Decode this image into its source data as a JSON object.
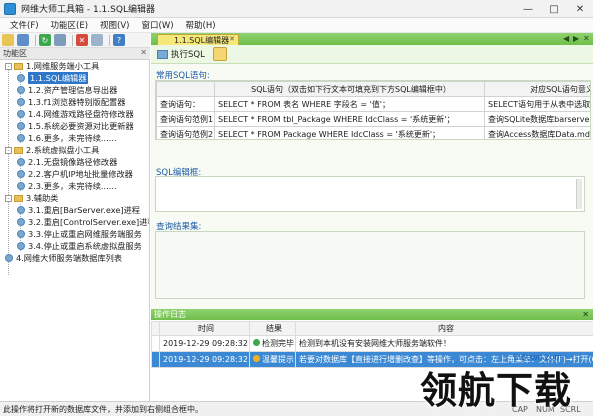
{
  "window": {
    "title": "网维大师工具箱 - 1.1.SQL编辑器"
  },
  "menu": [
    "文件(F)",
    "功能区(E)",
    "视图(V)",
    "窗口(W)",
    "帮助(H)"
  ],
  "left_panel": {
    "title": "功能区"
  },
  "tree": [
    {
      "label": "1.网维服务端小工具",
      "level": 0,
      "kind": "folder",
      "expanded": true
    },
    {
      "label": "1.1.SQL编辑器",
      "level": 1,
      "kind": "leaf",
      "selected": true
    },
    {
      "label": "1.2.资产管理信息导出器",
      "level": 1,
      "kind": "leaf"
    },
    {
      "label": "1.3.f1浏览器特别版配置器",
      "level": 1,
      "kind": "leaf"
    },
    {
      "label": "1.4.网维游戏路径盘符修改器",
      "level": 1,
      "kind": "leaf"
    },
    {
      "label": "1.5.系统必要资源对比更新器",
      "level": 1,
      "kind": "leaf"
    },
    {
      "label": "1.6.更多，未完待续......",
      "level": 1,
      "kind": "leaf"
    },
    {
      "label": "2.系统虚拟盘小工具",
      "level": 0,
      "kind": "folder",
      "expanded": true
    },
    {
      "label": "2.1.无盘镜像路径修改器",
      "level": 1,
      "kind": "leaf"
    },
    {
      "label": "2.2.客户机IP地址批量修改器",
      "level": 1,
      "kind": "leaf"
    },
    {
      "label": "2.3.更多，未完待续......",
      "level": 1,
      "kind": "leaf"
    },
    {
      "label": "3.辅助类",
      "level": 0,
      "kind": "folder",
      "expanded": true
    },
    {
      "label": "3.1.重启[BarServer.exe]进程",
      "level": 1,
      "kind": "leaf"
    },
    {
      "label": "3.2.重启[ControlServer.exe]进程",
      "level": 1,
      "kind": "leaf"
    },
    {
      "label": "3.3.停止或重启网维服务端服务",
      "level": 1,
      "kind": "leaf"
    },
    {
      "label": "3.4.停止或重启系统虚拟盘服务",
      "level": 1,
      "kind": "leaf"
    },
    {
      "label": "4.网维大师服务端数据库列表",
      "level": 0,
      "kind": "leaf"
    }
  ],
  "tab": {
    "label": "1.1.SQL编辑器"
  },
  "toolbar": {
    "execute_label": "执行SQL"
  },
  "common_sql": {
    "title": "常用SQL语句:",
    "columns": [
      "",
      "SQL语句（双击如下行文本可填充到下方SQL编辑框中）",
      "对应SQL语句意义"
    ],
    "rows": [
      [
        "查询语句：",
        "SELECT * FROM 表名 WHERE 字段名 = '值'；",
        "SELECT语句用于从表中选取"
      ],
      [
        "查询语句范例1：",
        "SELECT * FROM tbl_Package WHERE IdcClass = '系统更新'；",
        "查询SQLite数据库barserve"
      ],
      [
        "查询语句范例2：",
        "SELECT * FROM Package WHERE IdcClass = '系统更新'；",
        "查询Access数据库Data.md"
      ]
    ]
  },
  "sql_editor": {
    "title": "SQL编辑框:"
  },
  "query_result": {
    "title": "查询结果集:"
  },
  "log": {
    "title": "操作日志",
    "columns": [
      "",
      "时间",
      "结果",
      "内容"
    ],
    "rows": [
      {
        "time": "2019-12-29 09:28:32",
        "result": "检测完毕！",
        "content": "检测到本机没有安装网维大师服务端软件！",
        "selected": false
      },
      {
        "time": "2019-12-29 09:28:32",
        "result": "温馨提示！",
        "content": "若要对数据库【直接进行增删改查】等操作，可点击：左上角菜单：文件(F)→打开(O)",
        "selected": true
      }
    ]
  },
  "status": {
    "message": "此操作将打开新的数据库文件，并添加到右侧组合框中。",
    "caps": "CAP",
    "num": "NUM",
    "scrl": "SCRL"
  },
  "watermark": {
    "url": "lhdown.com",
    "text": "领航下载"
  },
  "colors": {
    "accent_green": "#6fbd4c",
    "selection_blue": "#2f78c9",
    "section_label": "#1d5aa8"
  }
}
